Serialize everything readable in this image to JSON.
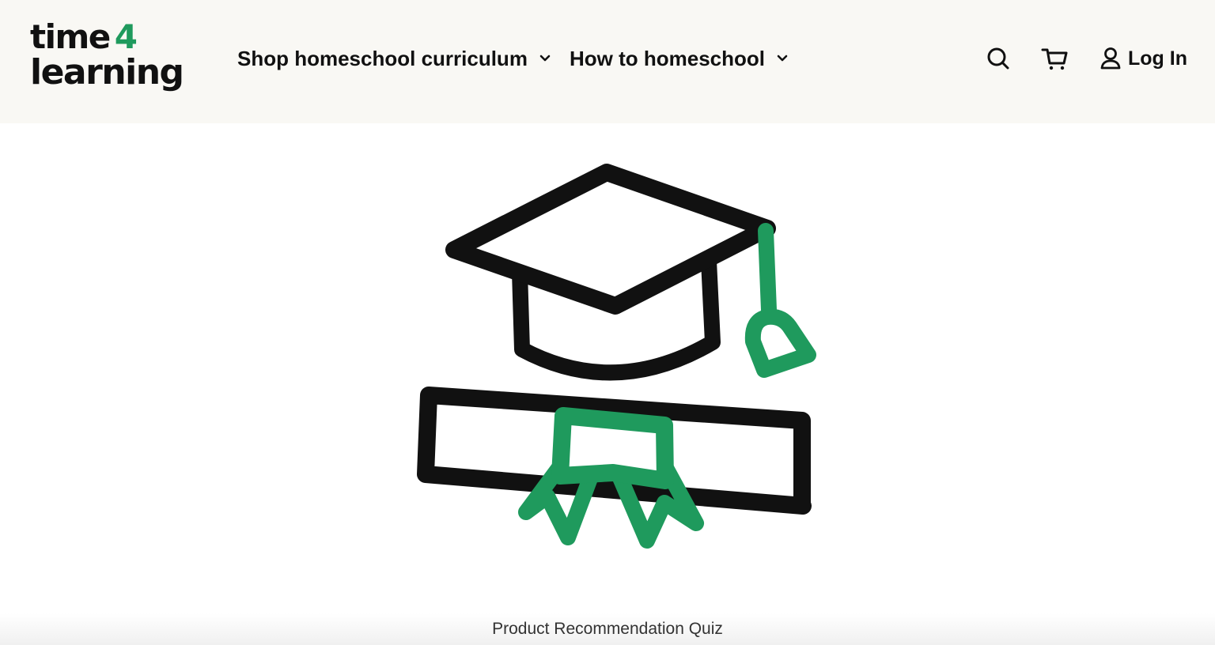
{
  "brand": {
    "logo_line1": "time",
    "logo_accent": "4",
    "logo_line2": "learning",
    "accent_color": "#1f9a5d"
  },
  "nav": {
    "items": [
      {
        "label": "Shop homeschool curriculum",
        "icon": "chevron-down-icon"
      },
      {
        "label": "How to homeschool",
        "icon": "chevron-down-icon"
      }
    ]
  },
  "header_actions": {
    "search_icon": "search-icon",
    "cart_icon": "cart-icon",
    "login_icon": "user-icon",
    "login_label": "Log In"
  },
  "hero": {
    "illustration": "graduation-cap-and-diploma-icon",
    "outline_color": "#111111",
    "accent_color": "#1f9a5d"
  },
  "quiz": {
    "title": "Product Recommendation Quiz"
  }
}
